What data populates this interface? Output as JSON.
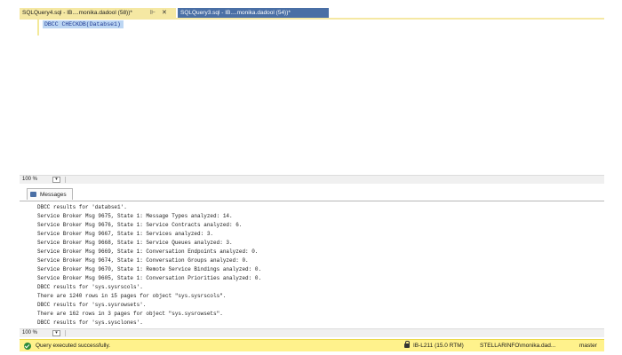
{
  "tabs": [
    {
      "label": "SQLQuery4.sql - IB....monika.dadool (58))*",
      "active": true,
      "pin": "⊩",
      "close": "✕"
    },
    {
      "label": "SQLQuery3.sql - IB....monika.dadool (54))*",
      "active": false
    }
  ],
  "editor": {
    "query": "DBCC CHECKDB(Databse1)"
  },
  "zoom_top": {
    "value": "100 %",
    "dropdown": "▾"
  },
  "results": {
    "tab_label": "Messages",
    "lines": [
      "DBCC results for 'databse1'.",
      "Service Broker Msg 9675, State 1: Message Types analyzed: 14.",
      "Service Broker Msg 9676, State 1: Service Contracts analyzed: 6.",
      "Service Broker Msg 9667, State 1: Services analyzed: 3.",
      "Service Broker Msg 9668, State 1: Service Queues analyzed: 3.",
      "Service Broker Msg 9669, State 1: Conversation Endpoints analyzed: 0.",
      "Service Broker Msg 9674, State 1: Conversation Groups analyzed: 0.",
      "Service Broker Msg 9670, State 1: Remote Service Bindings analyzed: 0.",
      "Service Broker Msg 9605, State 1: Conversation Priorities analyzed: 0.",
      "DBCC results for 'sys.sysrscols'.",
      "There are 1240 rows in 15 pages for object \"sys.sysrscols\".",
      "DBCC results for 'sys.sysrowsets'.",
      "There are 162 rows in 3 pages for object \"sys.sysrowsets\".",
      "DBCC results for 'sys.sysclones'."
    ]
  },
  "zoom_bottom": {
    "value": "100 %",
    "dropdown": "▾"
  },
  "status": {
    "message": "Query executed successfully.",
    "server": "IB-L211 (15.0 RTM)",
    "user": "STELLARINFO\\monika.dad...",
    "database": "master",
    "colors": {
      "bar": "#fff28c",
      "ok": "#2e8b3a"
    }
  }
}
